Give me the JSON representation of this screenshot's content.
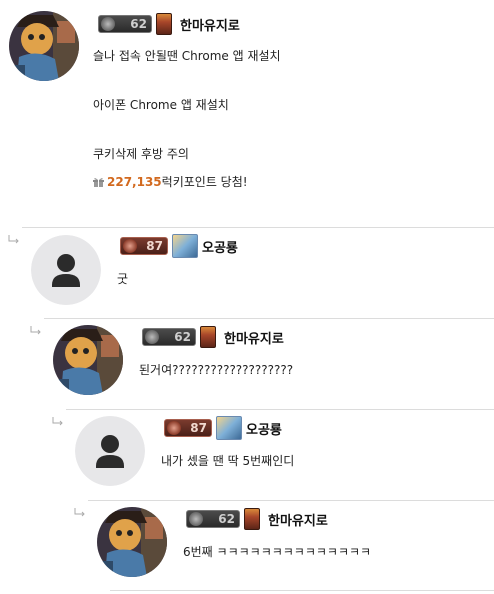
{
  "colors": {
    "divider": "#dcdcdc",
    "reward_amount": "#d2691e"
  },
  "comments": [
    {
      "nickname": "한마유지로",
      "level": "62",
      "level_tier": "silver",
      "avatar": "cat-character",
      "lines": [
        "슬나 접속 안될땐 Chrome 앱 재설치",
        "아이폰 Chrome 앱 재설치",
        "쿠키삭제 후방 주의"
      ],
      "reward": {
        "amount": "227,135",
        "suffix": "럭키포인트 당첨!"
      }
    },
    {
      "nickname": "오공룡",
      "level": "87",
      "level_tier": "bronze",
      "avatar": "default-user",
      "lines": [
        "굿"
      ]
    },
    {
      "nickname": "한마유지로",
      "level": "62",
      "level_tier": "silver",
      "avatar": "cat-character",
      "lines": [
        "된거여???????????????????"
      ]
    },
    {
      "nickname": "오공룡",
      "level": "87",
      "level_tier": "bronze",
      "avatar": "default-user",
      "lines": [
        "내가 셌을 땐 딱 5번째인디"
      ]
    },
    {
      "nickname": "한마유지로",
      "level": "62",
      "level_tier": "silver",
      "avatar": "cat-character",
      "lines": [
        "6번째 ㅋㅋㅋㅋㅋㅋㅋㅋㅋㅋㅋㅋㅋㅋ"
      ]
    }
  ]
}
